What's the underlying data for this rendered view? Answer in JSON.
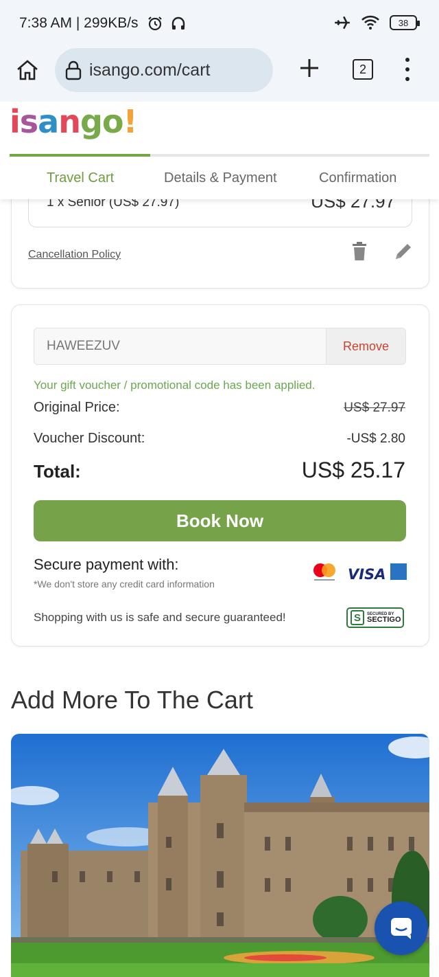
{
  "status_bar": {
    "time_speed": "7:38 AM | 299KB/s",
    "battery": "38"
  },
  "browser": {
    "url": "isango.com/cart",
    "tab_count": "2"
  },
  "site": {
    "logo": {
      "parts": [
        "i",
        "s",
        "a",
        "n",
        "g",
        "o",
        "!"
      ]
    },
    "steps": [
      "Travel Cart",
      "Details & Payment",
      "Confirmation"
    ]
  },
  "cart_item": {
    "ticket_line": "1 x Senior (US$ 27.97)",
    "ticket_price": "US$ 27.97",
    "cancellation_link": "Cancellation Policy"
  },
  "voucher": {
    "code": "HAWEEZUV",
    "remove_label": "Remove",
    "applied_message": "Your gift voucher / promotional code has been applied."
  },
  "summary": {
    "original_label": "Original Price:",
    "original_value": "US$ 27.97",
    "discount_label": "Voucher Discount:",
    "discount_value": "-US$ 2.80",
    "total_label": "Total:",
    "total_value": "US$ 25.17"
  },
  "book_button": "Book Now",
  "payment": {
    "secure_label": "Secure payment with:",
    "note": "*We don't store any credit card information",
    "visa": "VISA",
    "safe_text": "Shopping with us is safe and secure guaranteed!",
    "sectigo_top": "SECURED BY",
    "sectigo_bottom": "SECTIGO"
  },
  "add_more_heading": "Add More To The Cart",
  "colors": {
    "brand_green": "#76a34a",
    "remove_red": "#c9442e",
    "chat_blue": "#1a52b0"
  }
}
